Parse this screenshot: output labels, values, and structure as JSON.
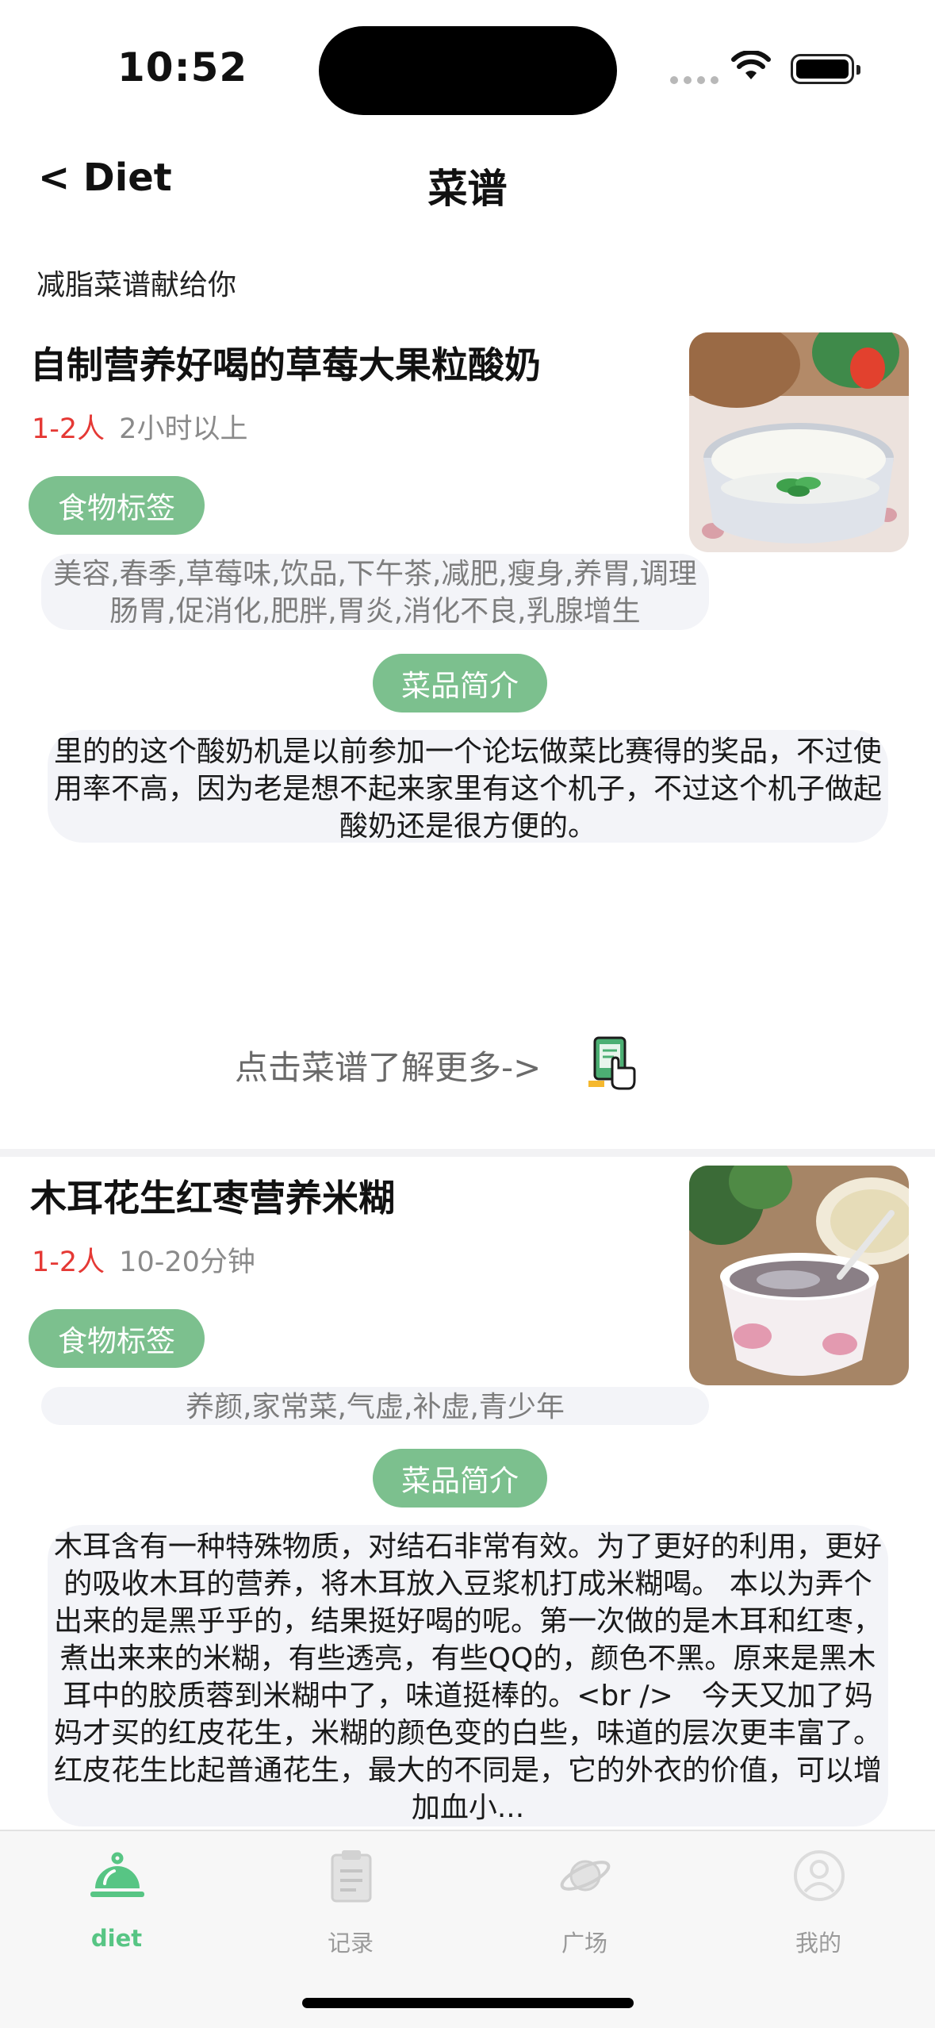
{
  "status_bar": {
    "time": "10:52"
  },
  "nav": {
    "back_label": "< Diet",
    "title": "菜谱"
  },
  "subtitle": "减脂菜谱献给你",
  "recipes": [
    {
      "title": "自制营养好喝的草莓大果粒酸奶",
      "servings": "1-2人",
      "duration": "2小时以上",
      "tags_label": "食物标签",
      "tags": "美容,春季,草莓味,饮品,下午茶,减肥,瘦身,养胃,调理肠胃,促消化,肥胖,胃炎,消化不良,乳腺增生",
      "intro_label": "菜品简介",
      "intro": "里的的这个酸奶机是以前参加一个论坛做菜比赛得的奖品，不过使用率不高，因为老是想不起来家里有这个机子，不过这个机子做起酸奶还是很方便的。"
    },
    {
      "title": "木耳花生红枣营养米糊",
      "servings": "1-2人",
      "duration": "10-20分钟",
      "tags_label": "食物标签",
      "tags": "养颜,家常菜,气虚,补虚,青少年",
      "intro_label": "菜品简介",
      "intro": "木耳含有一种特殊物质，对结石非常有效。为了更好的利用，更好的吸收木耳的营养，将木耳放入豆浆机打成米糊喝。 本以为弄个出来的是黑乎乎的，结果挺好喝的呢。第一次做的是木耳和红枣，煮出来来的米糊，有些透亮，有些QQ的，颜色不黑。原来是黑木耳中的胶质蓉到米糊中了，味道挺棒的。<br />　今天又加了妈妈才买的红皮花生，米糊的颜色变的白些，味道的层次更丰富了。红皮花生比起普通花生，最大的不同是，它的外衣的价值，可以增加血小..."
    }
  ],
  "more_link": "点击菜谱了解更多->",
  "tab_bar": {
    "items": [
      {
        "label": "diet",
        "icon": "cloche-icon",
        "active": true
      },
      {
        "label": "记录",
        "icon": "clipboard-icon",
        "active": false
      },
      {
        "label": "广场",
        "icon": "planet-icon",
        "active": false
      },
      {
        "label": "我的",
        "icon": "user-icon",
        "active": false
      }
    ]
  },
  "colors": {
    "accent": "#7cc08e",
    "active_tab": "#57c584",
    "servings": "#e53935"
  }
}
